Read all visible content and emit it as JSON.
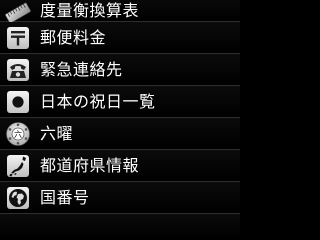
{
  "list": {
    "items": [
      {
        "label": "",
        "icon": "partial-row-icon"
      },
      {
        "label": "度量衡換算表",
        "icon": "ruler-icon"
      },
      {
        "label": "郵便料金",
        "icon": "postal-mark-icon"
      },
      {
        "label": "緊急連絡先",
        "icon": "telephone-icon"
      },
      {
        "label": "日本の祝日一覧",
        "icon": "japan-flag-icon"
      },
      {
        "label": "六曜",
        "icon": "rokuyo-wheel-icon"
      },
      {
        "label": "都道府県情報",
        "icon": "japan-map-icon"
      },
      {
        "label": "国番号",
        "icon": "globe-icon"
      }
    ]
  },
  "colors": {
    "background": "#000000",
    "text": "#ffffff",
    "divider": "#2e2e2e"
  }
}
